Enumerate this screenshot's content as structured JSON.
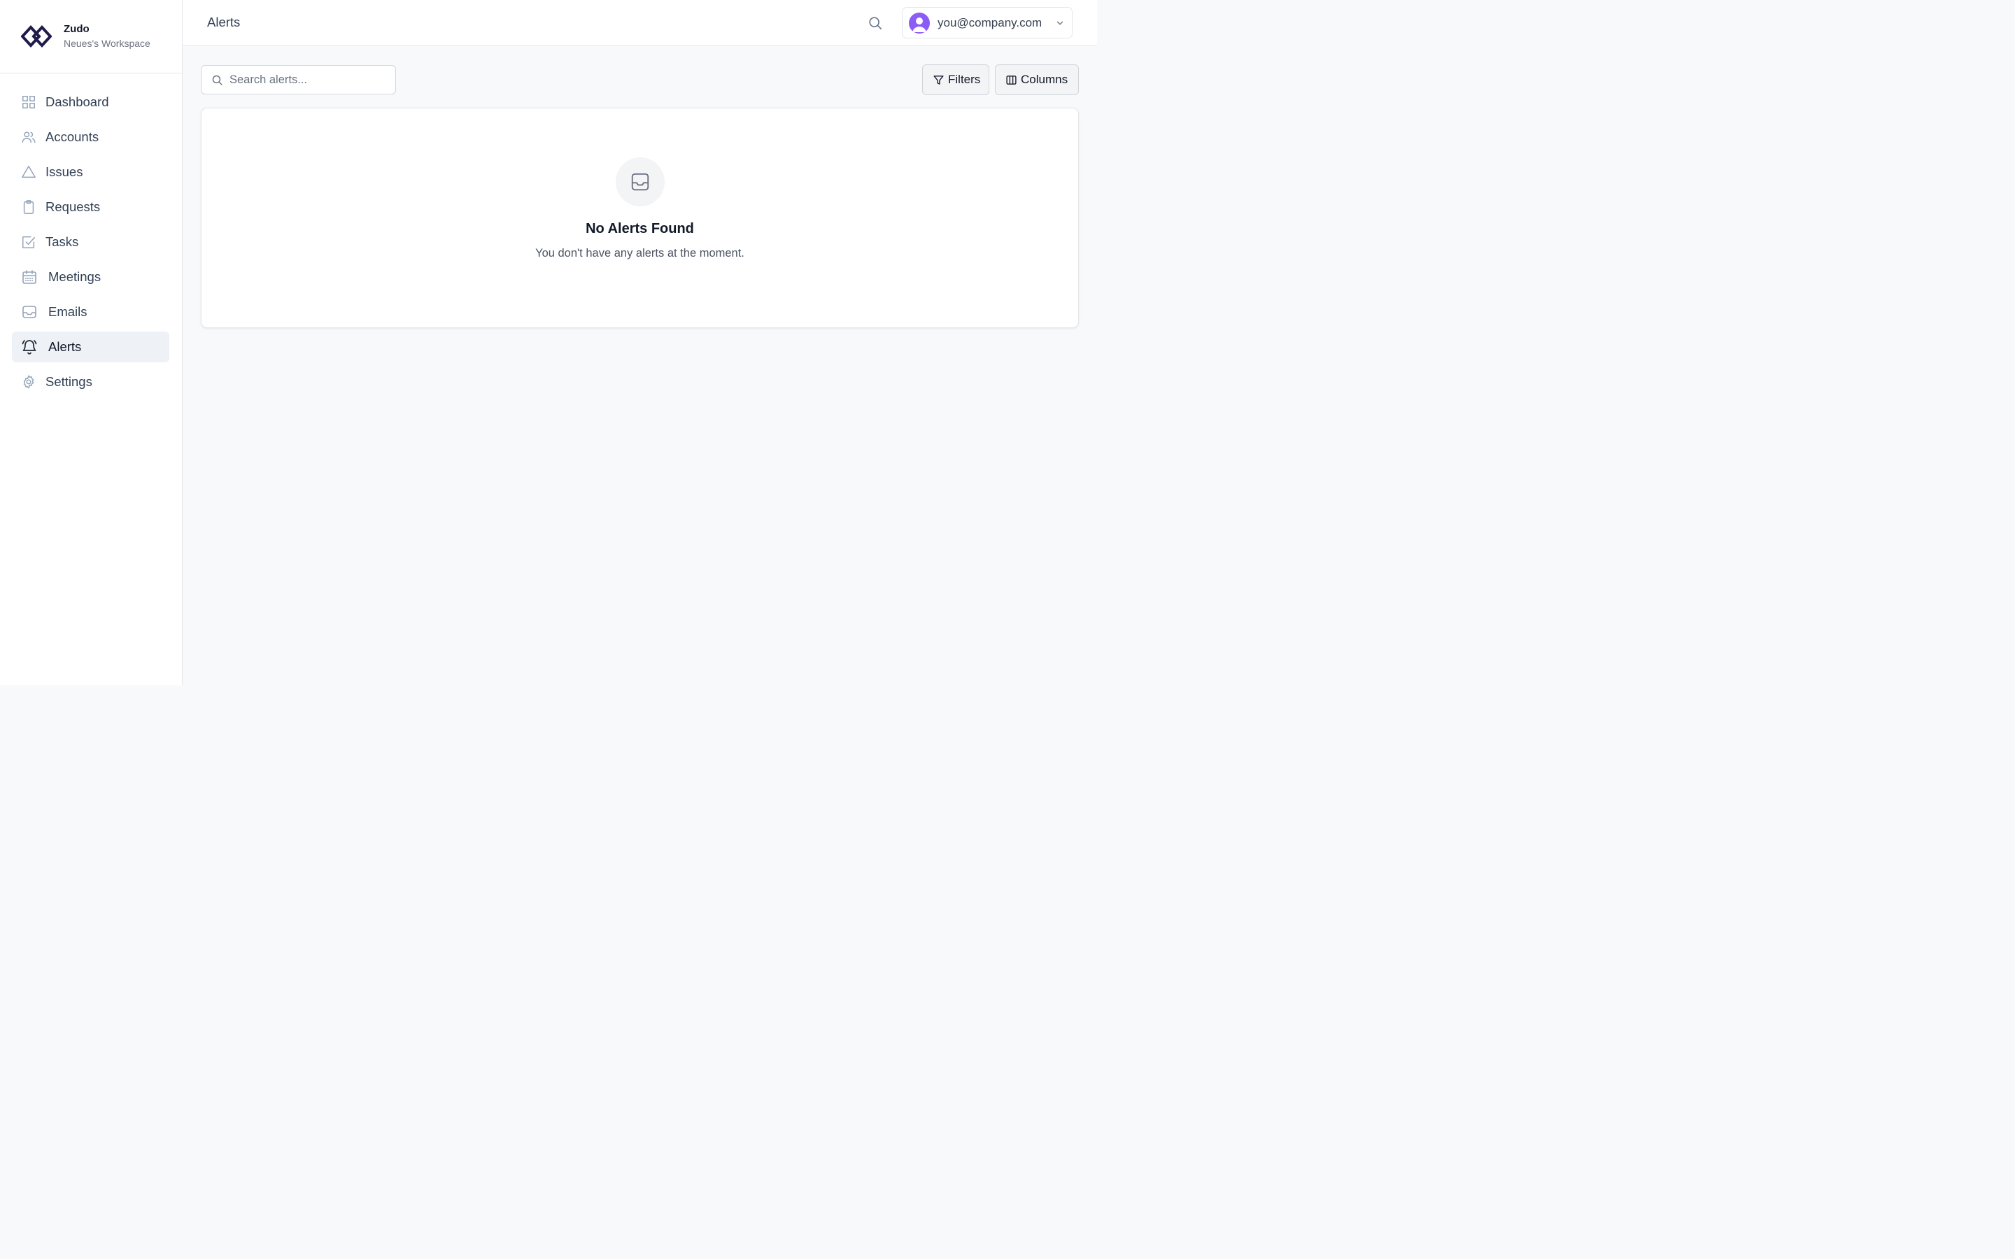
{
  "brand": {
    "name": "Zudo",
    "workspace": "Neues's Workspace"
  },
  "sidebar": {
    "items": [
      {
        "label": "Dashboard",
        "icon": "grid-icon"
      },
      {
        "label": "Accounts",
        "icon": "users-icon"
      },
      {
        "label": "Issues",
        "icon": "alert-triangle-icon"
      },
      {
        "label": "Requests",
        "icon": "clipboard-icon"
      },
      {
        "label": "Tasks",
        "icon": "check-square-icon"
      },
      {
        "label": "Meetings",
        "icon": "calendar-icon"
      },
      {
        "label": "Emails",
        "icon": "inbox-icon"
      },
      {
        "label": "Alerts",
        "icon": "bell-icon",
        "active": true
      },
      {
        "label": "Settings",
        "icon": "gear-icon"
      }
    ]
  },
  "header": {
    "title": "Alerts",
    "search_icon": "search-icon"
  },
  "user": {
    "email": "you@company.com",
    "avatar_color": "#8b5cf6"
  },
  "toolbar": {
    "search_placeholder": "Search alerts...",
    "filters_label": "Filters",
    "columns_label": "Columns"
  },
  "empty_state": {
    "icon": "inbox-icon",
    "title": "No Alerts Found",
    "message": "You don't have any alerts at the moment."
  },
  "colors": {
    "active_nav_bg": "#eef2f7",
    "page_bg": "#f8f9fb"
  }
}
